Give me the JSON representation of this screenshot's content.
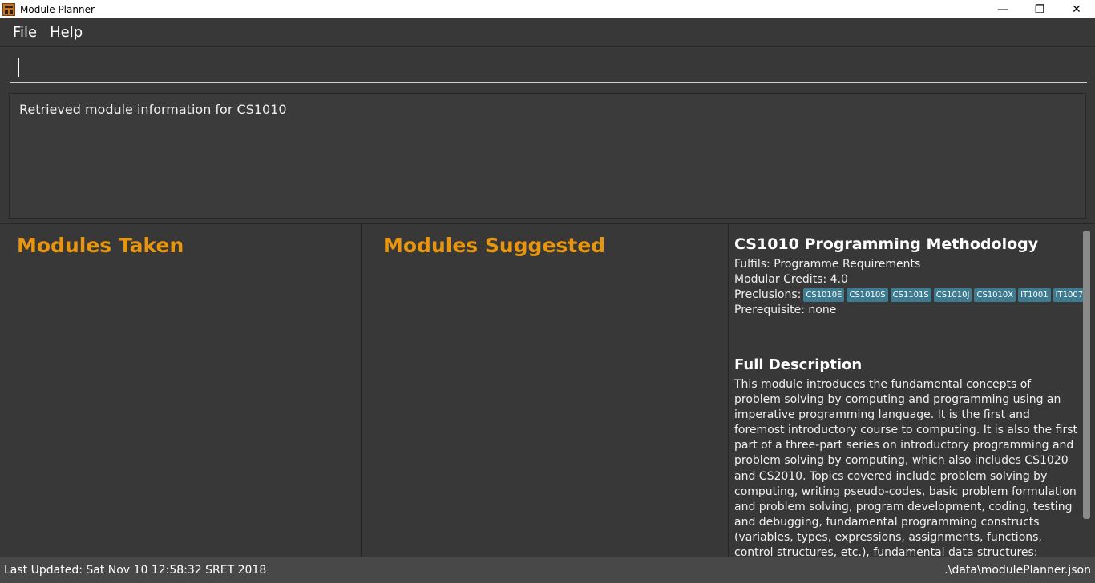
{
  "window": {
    "title": "Module Planner",
    "controls": {
      "minimize": "—",
      "restore": "❐",
      "close": "✕"
    }
  },
  "menu": {
    "file": "File",
    "help": "Help"
  },
  "command": {
    "value": "",
    "placeholder": ""
  },
  "result": {
    "message": "Retrieved module information for CS1010"
  },
  "panels": {
    "taken_title": "Modules Taken",
    "suggested_title": "Modules Suggested"
  },
  "module": {
    "title": "CS1010 Programming Methodology",
    "fulfils": "Fulfils: Programme Requirements",
    "credits": "Modular Credits: 4.0",
    "preclusions_label": "Preclusions:",
    "preclusions": [
      "CS1010E",
      "CS1010S",
      "CS1101S",
      "CS1010J",
      "CS1010X",
      "IT1001",
      "IT1007"
    ],
    "prerequisite": "Prerequisite: none",
    "description_title": "Full Description",
    "description": "This module introduces the fundamental concepts of problem solving by computing and programming using an imperative programming language. It is the first and foremost introductory course to computing. It is also the first part of a three-part series on introductory programming and problem solving by computing, which also includes CS1020 and CS2010. Topics covered include problem solving by computing, writing pseudo-codes, basic problem formulation and problem solving, program development, coding, testing and debugging, fundamental programming constructs (variables, types, expressions, assignments, functions, control structures, etc.), fundamental data structures: arrays, strings and structures,"
  },
  "status": {
    "last_updated": "Last Updated: Sat Nov 10 12:58:32 SRET 2018",
    "file_path": ".\\data\\modulePlanner.json"
  }
}
